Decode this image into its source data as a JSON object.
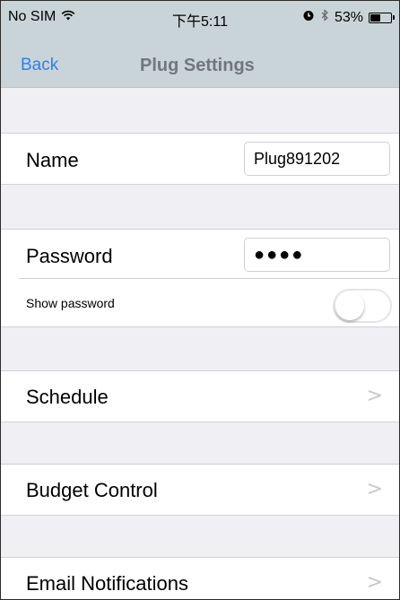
{
  "status_bar": {
    "carrier": "No SIM",
    "time": "下午5:11",
    "battery_percent": "53%",
    "battery_level": 0.53,
    "icons": [
      "wifi-icon",
      "alarm-icon",
      "bluetooth-icon",
      "battery-icon"
    ]
  },
  "nav": {
    "back_label": "Back",
    "title": "Plug Settings"
  },
  "settings": {
    "name_label": "Name",
    "name_value": "Plug891202",
    "password_label": "Password",
    "password_masked": "●●●●",
    "show_password_label": "Show password",
    "show_password_on": false,
    "schedule_label": "Schedule",
    "budget_label": "Budget Control",
    "email_label": "Email Notifications"
  },
  "colors": {
    "nav_bg": "#c9d4d8",
    "accent_blue": "#2f7ff0",
    "title_gray": "#6f777b",
    "group_bg": "#efeff4"
  }
}
